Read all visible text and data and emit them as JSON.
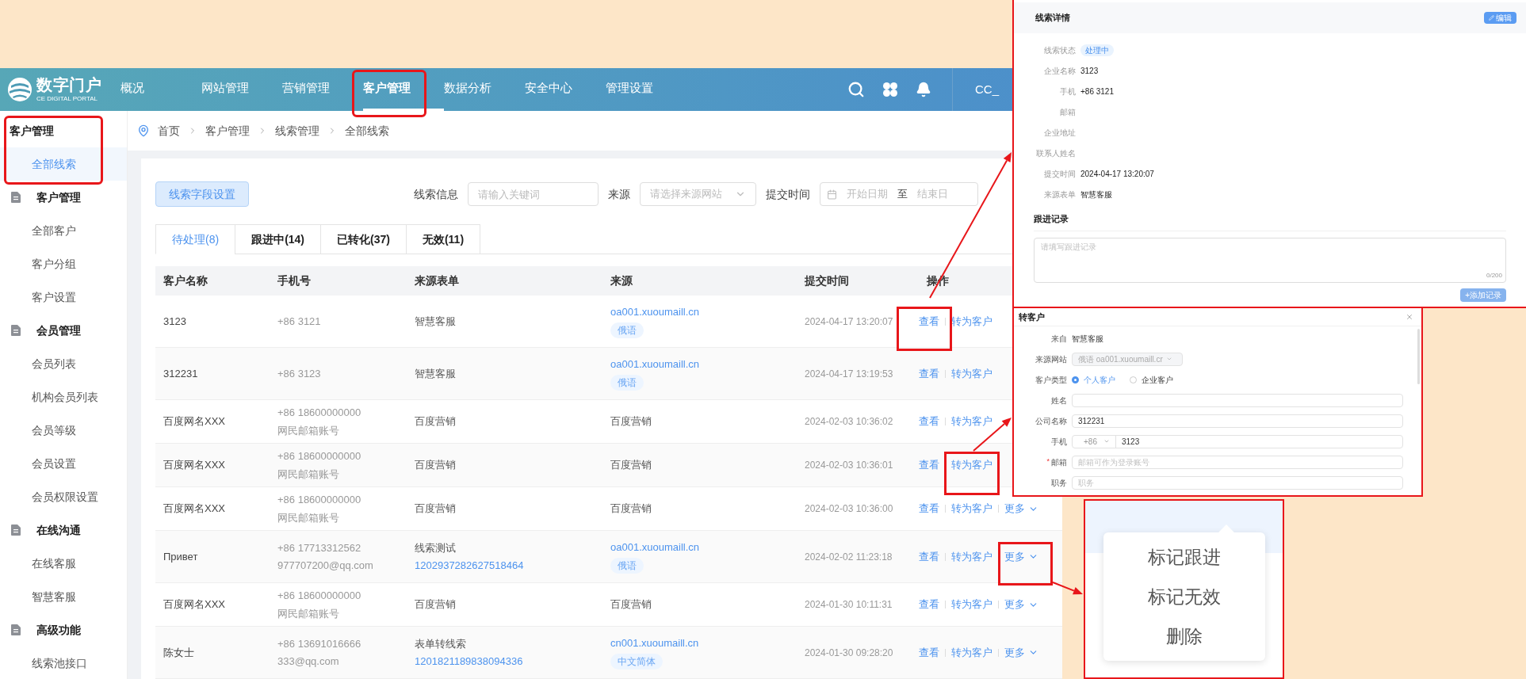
{
  "header": {
    "logo_text": "数字门户",
    "logo_subtitle": "CE DIGITAL PORTAL",
    "user": "CC_",
    "nav": [
      {
        "label": "概况",
        "selected": false
      },
      {
        "label": "网站管理",
        "selected": false
      },
      {
        "label": "营销管理",
        "selected": false
      },
      {
        "label": "客户管理",
        "selected": true
      },
      {
        "label": "数据分析",
        "selected": false
      },
      {
        "label": "安全中心",
        "selected": false
      },
      {
        "label": "管理设置",
        "selected": false
      }
    ]
  },
  "sidebar": {
    "sections": [
      {
        "kind": "heading",
        "label": "客户管理",
        "children": [
          {
            "label": "全部线索",
            "selected": true
          }
        ]
      },
      {
        "kind": "group",
        "label": "客户管理",
        "children": [
          {
            "label": "全部客户",
            "selected": false
          },
          {
            "label": "客户分组",
            "selected": false
          },
          {
            "label": "客户设置",
            "selected": false
          }
        ]
      },
      {
        "kind": "group",
        "label": "会员管理",
        "children": [
          {
            "label": "会员列表",
            "selected": false
          },
          {
            "label": "机构会员列表",
            "selected": false
          },
          {
            "label": "会员等级",
            "selected": false
          },
          {
            "label": "会员设置",
            "selected": false
          },
          {
            "label": "会员权限设置",
            "selected": false
          }
        ]
      },
      {
        "kind": "group",
        "label": "在线沟通",
        "children": [
          {
            "label": "在线客服",
            "selected": false
          },
          {
            "label": "智慧客服",
            "selected": false
          }
        ]
      },
      {
        "kind": "group",
        "label": "高级功能",
        "children": [
          {
            "label": "线索池接口",
            "selected": false
          }
        ]
      }
    ]
  },
  "breadcrumb": [
    "首页",
    "客户管理",
    "线索管理",
    "全部线索"
  ],
  "filters": {
    "field_button": "线索字段设置",
    "keyword": {
      "label": "线索信息",
      "placeholder": "请输入关键词"
    },
    "source": {
      "label": "来源",
      "placeholder": "请选择来源网站"
    },
    "date": {
      "label": "提交时间",
      "start_placeholder": "开始日期",
      "separator": "至",
      "end_placeholder": "结束日"
    }
  },
  "tabs": [
    {
      "label": "待处理(8)",
      "selected": true
    },
    {
      "label": "跟进中(14)",
      "selected": false
    },
    {
      "label": "已转化(37)",
      "selected": false
    },
    {
      "label": "无效(11)",
      "selected": false
    }
  ],
  "table": {
    "columns": [
      "客户名称",
      "手机号",
      "来源表单",
      "来源",
      "提交时间",
      "操作"
    ],
    "rows": [
      {
        "name": "3123",
        "phone": [
          "+86 3121"
        ],
        "form": {
          "title": "智慧客服"
        },
        "source": {
          "kind": "site",
          "link": "oa001.xuoumaill.cn",
          "tag": "俄语"
        },
        "time": "2024-04-17 13:20:07",
        "actions": [
          "查看",
          "转为客户"
        ]
      },
      {
        "name": "312231",
        "phone": [
          "+86 3123"
        ],
        "form": {
          "title": "智慧客服"
        },
        "source": {
          "kind": "site",
          "link": "oa001.xuoumaill.cn",
          "tag": "俄语"
        },
        "time": "2024-04-17 13:19:53",
        "actions": [
          "查看",
          "转为客户"
        ]
      },
      {
        "name": "百度网名XXX",
        "phone": [
          "+86 18600000000",
          "网民邮箱账号"
        ],
        "form": {
          "title": "百度营销"
        },
        "source": {
          "kind": "text",
          "text": "百度营销"
        },
        "time": "2024-02-03 10:36:02",
        "actions": [
          "查看",
          "转为客户"
        ]
      },
      {
        "name": "百度网名XXX",
        "phone": [
          "+86 18600000000",
          "网民邮箱账号"
        ],
        "form": {
          "title": "百度营销"
        },
        "source": {
          "kind": "text",
          "text": "百度营销"
        },
        "time": "2024-02-03 10:36:01",
        "actions": [
          "查看",
          "转为客户"
        ]
      },
      {
        "name": "百度网名XXX",
        "phone": [
          "+86 18600000000",
          "网民邮箱账号"
        ],
        "form": {
          "title": "百度营销"
        },
        "source": {
          "kind": "text",
          "text": "百度营销"
        },
        "time": "2024-02-03 10:36:00",
        "actions": [
          "查看",
          "转为客户"
        ],
        "more": "更多"
      },
      {
        "name": "Привет",
        "phone": [
          "+86 17713312562",
          "977707200@qq.com"
        ],
        "form": {
          "title": "线索测试",
          "link": "1202937282627518464"
        },
        "source": {
          "kind": "site",
          "link": "oa001.xuoumaill.cn",
          "tag": "俄语"
        },
        "time": "2024-02-02 11:23:18",
        "actions": [
          "查看",
          "转为客户"
        ],
        "more": "更多"
      },
      {
        "name": "百度网名XXX",
        "phone": [
          "+86 18600000000",
          "网民邮箱账号"
        ],
        "form": {
          "title": "百度营销"
        },
        "source": {
          "kind": "text",
          "text": "百度营销"
        },
        "time": "2024-01-30 10:11:31",
        "actions": [
          "查看",
          "转为客户"
        ],
        "more": "更多"
      },
      {
        "name": "陈女士",
        "phone": [
          "+86 13691016666",
          "333@qq.com"
        ],
        "form": {
          "title": "表单转线索",
          "link": "1201821189838094336"
        },
        "source": {
          "kind": "site",
          "link": "cn001.xuoumaill.cn",
          "tag": "中文简体"
        },
        "time": "2024-01-30 09:28:20",
        "actions": [
          "查看",
          "转为客户"
        ],
        "more": "更多"
      }
    ]
  },
  "detail": {
    "title": "线索详情",
    "edit_button": "编辑",
    "fields": [
      {
        "label": "线索状态",
        "kind": "tag",
        "value": "处理中"
      },
      {
        "label": "企业名称",
        "kind": "text",
        "value": "3123"
      },
      {
        "label": "手机",
        "kind": "text",
        "value": "+86 3121"
      },
      {
        "label": "邮箱"
      },
      {
        "label": "企业地址"
      },
      {
        "label": "联系人姓名"
      },
      {
        "label": "提交时间",
        "kind": "text",
        "value": "2024-04-17 13:20:07"
      },
      {
        "label": "来源表单",
        "kind": "text",
        "value": "智慧客服"
      }
    ],
    "follow_title": "跟进记录",
    "follow_placeholder": "请填写跟进记录",
    "counter": "0/200",
    "add_button": "+添加记录",
    "add_disabled": true
  },
  "dialog": {
    "title": "转客户",
    "fields": [
      {
        "kind": "static",
        "label": "来自",
        "value": "智慧客服"
      },
      {
        "kind": "select",
        "label": "来源网站",
        "value": "俄语 oa001.xuoumaill.cr",
        "disabled": true
      },
      {
        "kind": "radio",
        "label": "客户类型",
        "options": [
          {
            "label": "个人客户",
            "selected": true
          },
          {
            "label": "企业客户",
            "selected": false
          }
        ]
      },
      {
        "kind": "input",
        "label": "姓名"
      },
      {
        "kind": "input",
        "label": "公司名称",
        "value": "312231"
      },
      {
        "kind": "phone",
        "label": "手机",
        "code": "+86",
        "value": "3123"
      },
      {
        "kind": "input",
        "label": "邮箱",
        "required_mark": "*",
        "placeholder": "邮箱可作为登录账号"
      },
      {
        "kind": "input",
        "label": "职务",
        "placeholder": "职务"
      }
    ]
  },
  "more_menu": {
    "items": [
      "标记跟进",
      "标记无效",
      "删除"
    ]
  }
}
